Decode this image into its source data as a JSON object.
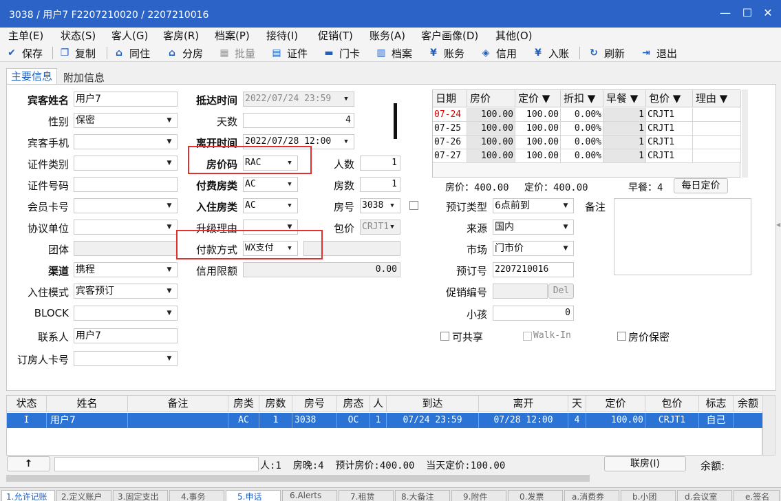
{
  "window": {
    "title": "3038 / 用户7 F2207210020 / 2207210016",
    "minimize": "—",
    "maximize": "☐",
    "close": "✕"
  },
  "menu": [
    "主单(E)",
    "状态(S)",
    "客人(G)",
    "客房(R)",
    "档案(P)",
    "接待(I)",
    "促销(T)",
    "账务(A)",
    "客户画像(D)",
    "其他(O)"
  ],
  "toolbar": {
    "save": "保存",
    "copy": "复制",
    "share": "同住",
    "split": "分房",
    "batch": "批量",
    "cert": "证件",
    "card": "门卡",
    "archive": "档案",
    "account": "账务",
    "credit": "信用",
    "post": "入账",
    "refresh": "刷新",
    "exit": "退出"
  },
  "tabs": {
    "main": "主要信息",
    "extra": "附加信息"
  },
  "form": {
    "guest_name_label": "宾客姓名",
    "guest_name": "用户7",
    "gender_label": "性别",
    "gender": "保密",
    "mobile_label": "宾客手机",
    "mobile": "",
    "id_type_label": "证件类别",
    "id_type": "",
    "id_no_label": "证件号码",
    "id_no": "",
    "member_label": "会员卡号",
    "member": "",
    "company_label": "协议单位",
    "company": "",
    "group_label": "团体",
    "group": "",
    "channel_label": "渠道",
    "channel": "携程",
    "checkin_mode_label": "入住模式",
    "checkin_mode": "宾客预订",
    "block_label": "BLOCK",
    "block": "",
    "contact_label": "联系人",
    "contact": "用户7",
    "booker_card_label": "订房人卡号",
    "booker_card": "",
    "arrival_label": "抵达时间",
    "arrival": "2022/07/24 23:59",
    "days_label": "天数",
    "days": "4",
    "departure_label": "离开时间",
    "departure": "2022/07/28 12:00",
    "rate_code_label": "房价码",
    "rate_code": "RAC",
    "pay_room_type_label": "付费房类",
    "pay_room_type": "AC",
    "room_type_label": "入住房类",
    "room_type": "AC",
    "upgrade_label": "升级理由",
    "upgrade": "",
    "payment_label": "付款方式",
    "payment": "WX支付",
    "credit_limit_label": "信用限额",
    "credit_limit": "0.00",
    "persons_label": "人数",
    "persons": "1",
    "rooms_label": "房数",
    "rooms": "1",
    "room_no_label": "房号",
    "room_no": "3038",
    "package_label": "包价",
    "package": "CRJT1",
    "booking_type_label": "预订类型",
    "booking_type": "6点前到",
    "source_label": "来源",
    "source": "国内",
    "market_label": "市场",
    "market": "门市价",
    "booking_no_label": "预订号",
    "booking_no": "2207210016",
    "promo_label": "促销编号",
    "promo": "",
    "promo_del": "Del",
    "child_label": "小孩",
    "child": "0",
    "remark_label": "备注",
    "remark": "",
    "shareable": "可共享",
    "walkin": "Walk-In",
    "rate_secret": "房价保密"
  },
  "rate_grid": {
    "headers": [
      "日期",
      "房价",
      "定价 ▼",
      "折扣 ▼",
      "早餐 ▼",
      "包价 ▼",
      "理由 ▼"
    ],
    "rows": [
      [
        "07-24",
        "100.00",
        "100.00",
        "0.00%",
        "1",
        "CRJT1",
        ""
      ],
      [
        "07-25",
        "100.00",
        "100.00",
        "0.00%",
        "1",
        "CRJT1",
        ""
      ],
      [
        "07-26",
        "100.00",
        "100.00",
        "0.00%",
        "1",
        "CRJT1",
        ""
      ],
      [
        "07-27",
        "100.00",
        "100.00",
        "0.00%",
        "1",
        "CRJT1",
        ""
      ]
    ],
    "summary_price": "房价：400.00",
    "summary_fixed": "定价：400.00",
    "summary_breakfast": "早餐：4",
    "daily_button": "每日定价"
  },
  "list": {
    "headers": [
      "状态",
      "姓名",
      "备注",
      "房类",
      "房数",
      "房号",
      "房态",
      "人",
      "到达",
      "离开",
      "天",
      "定价",
      "包价",
      "标志",
      "余额"
    ],
    "row": [
      "I",
      "用户7",
      "",
      "AC",
      "1",
      "3038",
      "OC",
      "1",
      "07/24 23:59",
      "07/28 12:00",
      "4",
      "100.00",
      "CRJT1",
      "自己",
      ""
    ]
  },
  "status": {
    "up": "↑",
    "text": "人:1  房晚:4  预计房价:400.00  当天定价:100.00",
    "link_button": "联房(I)",
    "balance": "余额:"
  },
  "bottom_tabs": [
    "1.允许记账",
    "2.定义账户",
    "3.固定支出",
    "4.事务",
    "5.申话",
    "6.Alerts",
    "7.租赁",
    "8.大备注",
    "9.附件",
    "0.发票",
    "a.消费券",
    "b.小团",
    "d.会议室",
    "e.签名"
  ]
}
